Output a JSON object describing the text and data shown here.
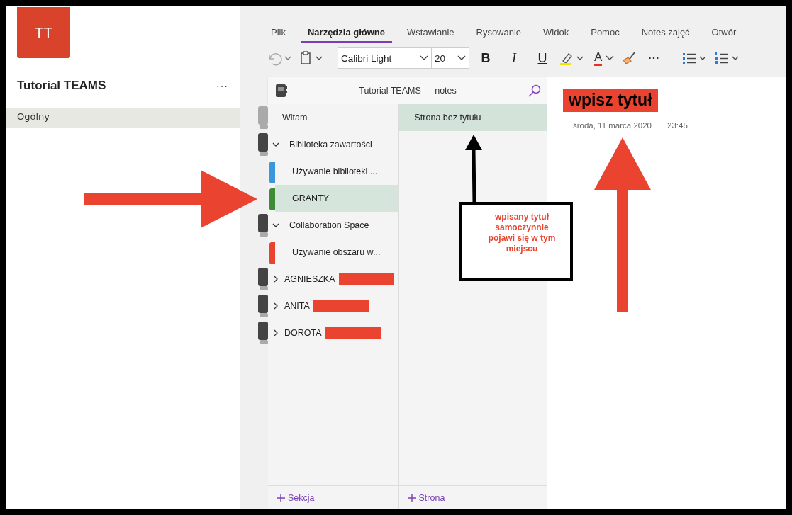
{
  "team": {
    "avatar": "TT",
    "name": "Tutorial TEAMS",
    "more": "···",
    "channels": [
      {
        "label": "Ogólny",
        "selected": true
      }
    ]
  },
  "ribbon": {
    "tabs": [
      {
        "label": "Plik",
        "selected": false
      },
      {
        "label": "Narzędzia główne",
        "selected": true
      },
      {
        "label": "Wstawianie",
        "selected": false
      },
      {
        "label": "Rysowanie",
        "selected": false
      },
      {
        "label": "Widok",
        "selected": false
      },
      {
        "label": "Pomoc",
        "selected": false
      },
      {
        "label": "Notes zajęć",
        "selected": false
      },
      {
        "label": "Otwór",
        "selected": false
      }
    ],
    "toolbar": {
      "font": "Calibri Light",
      "size": "20",
      "bold": "B",
      "italic": "I",
      "underline": "U",
      "font_color_letter": "A",
      "more": "···"
    }
  },
  "notebook": {
    "title": "Tutorial TEAMS — notes",
    "add_section": "Sekcja",
    "sections": [
      {
        "kind": "section",
        "label": "Witam",
        "selected": false
      },
      {
        "kind": "group",
        "label": "_Biblioteka zawartości",
        "expanded": true,
        "children": [
          {
            "kind": "section",
            "label": "Używanie biblioteki ...",
            "color": "#3a96dd",
            "selected": false
          },
          {
            "kind": "section",
            "label": "GRANTY",
            "color": "#3d8b37",
            "selected": true
          }
        ]
      },
      {
        "kind": "group",
        "label": "_Collaboration Space",
        "expanded": true,
        "children": [
          {
            "kind": "section",
            "label": "Używanie obszaru w...",
            "color": "#e8432e",
            "selected": false
          }
        ]
      },
      {
        "kind": "group",
        "label": "AGNIESZKA",
        "expanded": false,
        "redacted": true
      },
      {
        "kind": "group",
        "label": "ANITA",
        "expanded": false,
        "redacted": true
      },
      {
        "kind": "group",
        "label": "DOROTA",
        "expanded": false,
        "redacted": true
      }
    ]
  },
  "pages": {
    "add_page": "Strona",
    "items": [
      {
        "title": "Strona bez tytułu",
        "selected": true
      }
    ]
  },
  "page": {
    "title": "wpisz tytuł",
    "date": "środa, 11 marca 2020",
    "time": "23:45"
  },
  "annotations": {
    "callout": "wpisany tytuł samoczynnie pojawi się w tym miejscu"
  }
}
